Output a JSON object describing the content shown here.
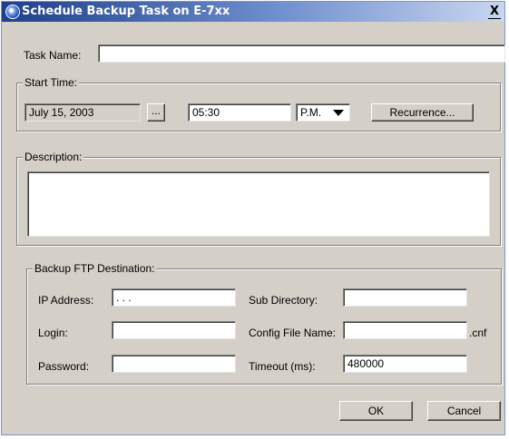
{
  "window": {
    "title": "Schedule Backup Task on E-7xx",
    "close_glyph": "X"
  },
  "task": {
    "label": "Task Name:",
    "value": ""
  },
  "start_time": {
    "group_label": "Start Time:",
    "date_value": "July 15, 2003",
    "date_picker_label": "...",
    "time_value": "05:30",
    "ampm_value": "P.M.",
    "recurrence_label": "Recurrence..."
  },
  "description": {
    "group_label": "Description:",
    "value": ""
  },
  "ftp": {
    "group_label": "Backup FTP Destination:",
    "ip_label": "IP Address:",
    "ip_value": " .  .  .",
    "login_label": "Login:",
    "login_value": "",
    "password_label": "Password:",
    "password_value": "",
    "subdir_label": "Sub Directory:",
    "subdir_value": "",
    "config_label": "Config File Name:",
    "config_value": "",
    "config_suffix": ".cnf",
    "timeout_label": "Timeout (ms):",
    "timeout_value": "480000"
  },
  "buttons": {
    "ok": "OK",
    "cancel": "Cancel"
  }
}
